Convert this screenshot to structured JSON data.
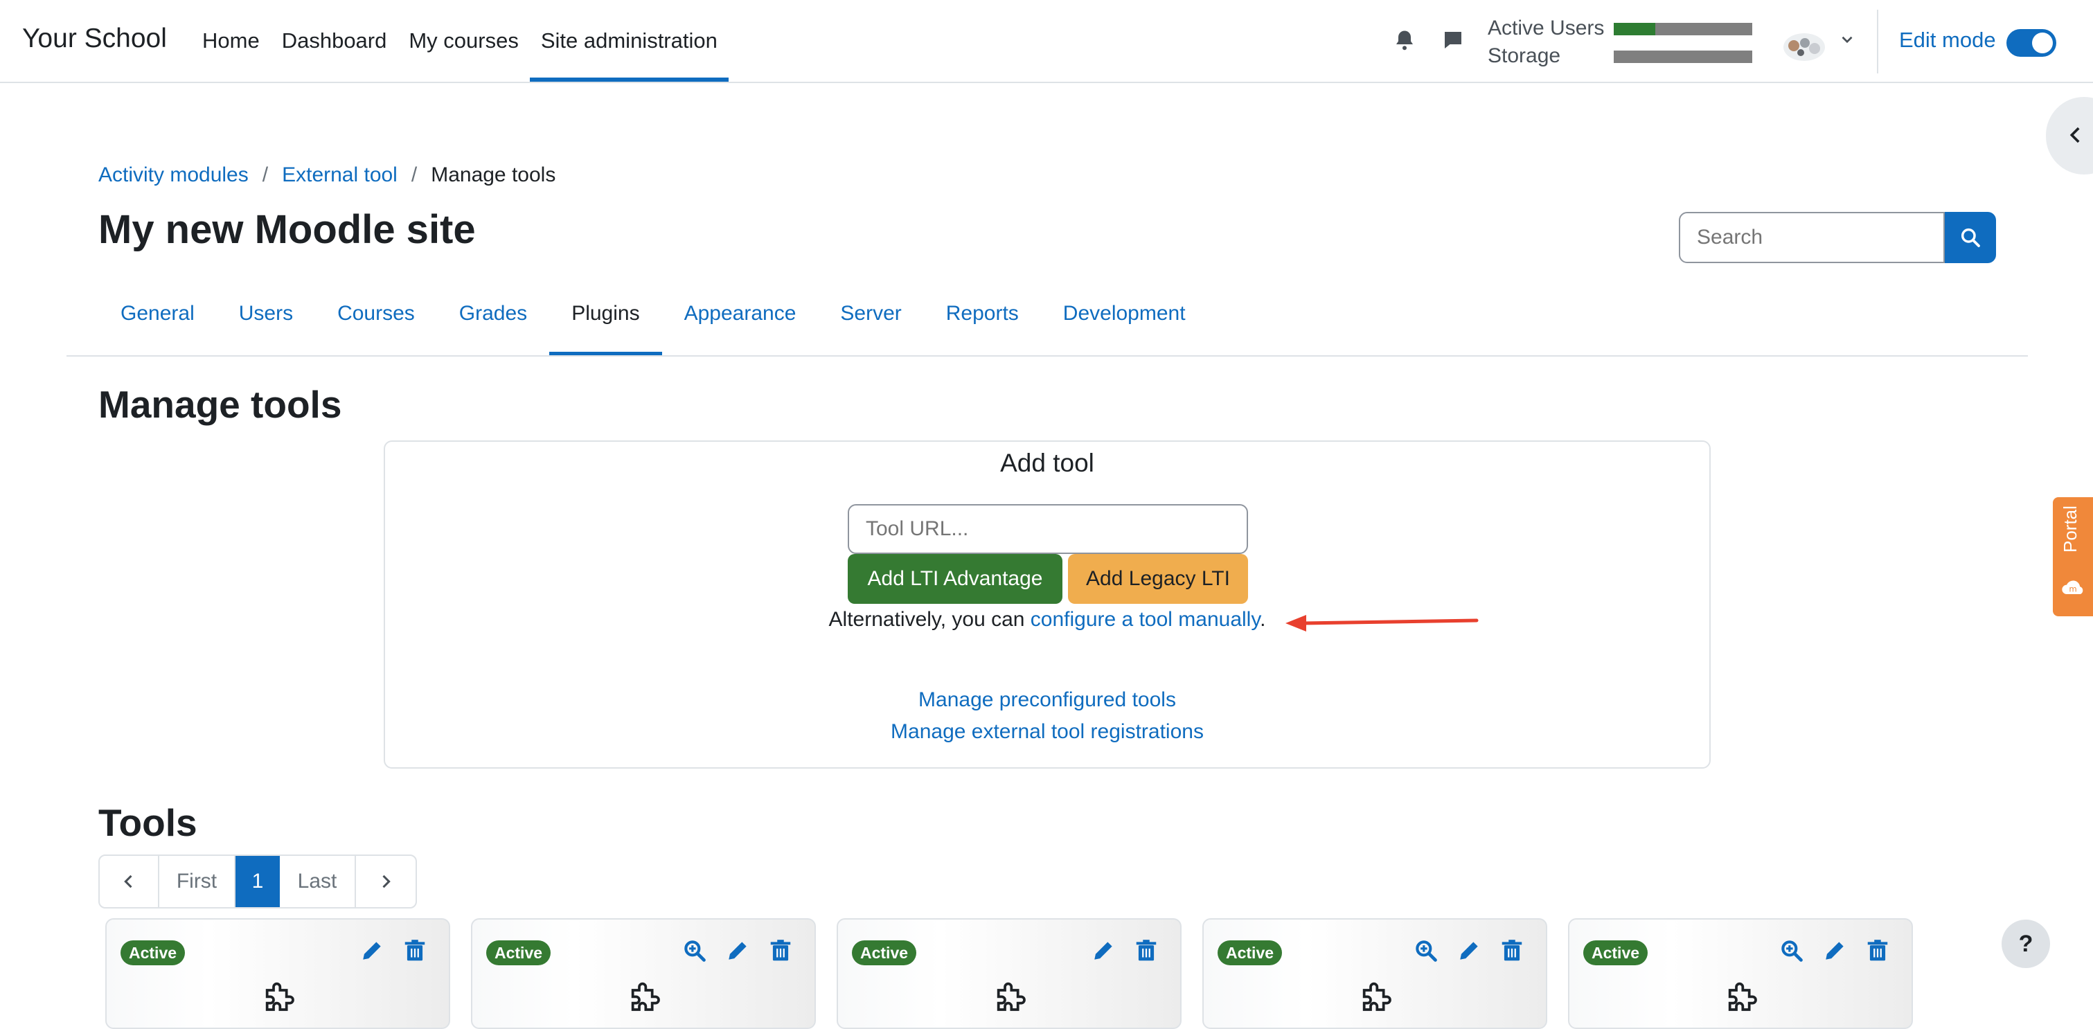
{
  "navbar": {
    "brand": "Your School",
    "items": [
      {
        "label": "Home"
      },
      {
        "label": "Dashboard"
      },
      {
        "label": "My courses"
      },
      {
        "label": "Site administration",
        "active": true
      }
    ],
    "quota": {
      "active_users_label": "Active Users",
      "active_users_fraction": 0.3,
      "storage_label": "Storage",
      "storage_fraction": 0.0
    },
    "edit_mode_label": "Edit mode",
    "edit_mode_on": true
  },
  "breadcrumb": [
    {
      "label": "Activity modules",
      "link": true
    },
    {
      "label": "External tool",
      "link": true
    },
    {
      "label": "Manage tools",
      "link": false
    }
  ],
  "page_title": "My new Moodle site",
  "search": {
    "placeholder": "Search"
  },
  "tabs": [
    {
      "label": "General"
    },
    {
      "label": "Users"
    },
    {
      "label": "Courses"
    },
    {
      "label": "Grades"
    },
    {
      "label": "Plugins",
      "active": true
    },
    {
      "label": "Appearance"
    },
    {
      "label": "Server"
    },
    {
      "label": "Reports"
    },
    {
      "label": "Development"
    }
  ],
  "manage_tools_heading": "Manage tools",
  "add_tool": {
    "title": "Add tool",
    "url_placeholder": "Tool URL...",
    "lti_advantage_button": "Add LTI Advantage",
    "legacy_lti_button": "Add Legacy LTI",
    "alt_prefix": "Alternatively, you can ",
    "alt_link": "configure a tool manually",
    "alt_suffix": ".",
    "link_preconfigured": "Manage preconfigured tools",
    "link_registrations": "Manage external tool registrations"
  },
  "tools_heading": "Tools",
  "pagination": {
    "first": "First",
    "current": "1",
    "last": "Last"
  },
  "tool_cards": [
    {
      "status": "Active",
      "icons": [
        "edit-icon",
        "delete-icon"
      ]
    },
    {
      "status": "Active",
      "icons": [
        "zoom-icon",
        "edit-icon",
        "delete-icon"
      ]
    },
    {
      "status": "Active",
      "icons": [
        "edit-icon",
        "delete-icon"
      ]
    },
    {
      "status": "Active",
      "icons": [
        "zoom-icon",
        "edit-icon",
        "delete-icon"
      ]
    },
    {
      "status": "Active",
      "icons": [
        "zoom-icon",
        "edit-icon",
        "delete-icon"
      ]
    }
  ],
  "portal_label": "Portal",
  "help_label": "?",
  "colors": {
    "brand_blue": "#0f6cbf",
    "success_green": "#357a32",
    "warning_orange": "#f0ad4e",
    "annotation_arrow": "#e8402e"
  }
}
